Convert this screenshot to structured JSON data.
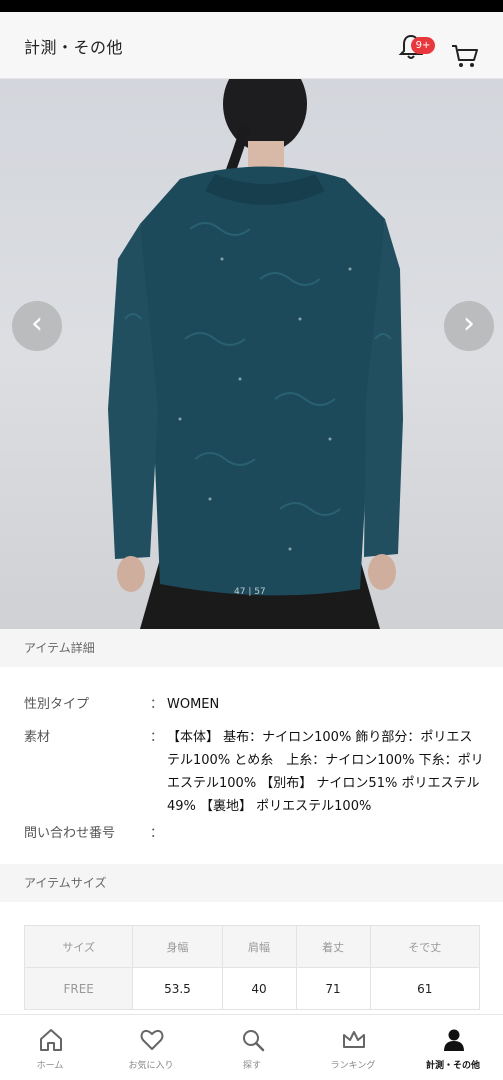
{
  "header": {
    "title": "計測・その他",
    "notification_badge": "9+",
    "bell_icon": "bell-icon",
    "cart_icon": "cart-icon"
  },
  "gallery": {
    "counter": "47 | 57",
    "prev_icon": "chevron-left-icon",
    "next_icon": "chevron-right-icon"
  },
  "item_details": {
    "heading": "アイテム詳細",
    "rows": [
      {
        "label": "性別タイプ",
        "colon": "：",
        "value": "WOMEN"
      },
      {
        "label": "素材",
        "colon": "：",
        "value": "【本体】 基布：ナイロン100% 飾り部分：ポリエステル100% とめ糸　上糸：ナイロン100% 下糸：ポリエステル100% 【別布】 ナイロン51% ポリエステル49% 【裏地】 ポリエステル100%"
      },
      {
        "label": "問い合わせ番号",
        "colon": "：",
        "value": ""
      }
    ]
  },
  "item_size": {
    "heading": "アイテムサイズ",
    "columns": [
      "サイズ",
      "身幅",
      "肩幅",
      "着丈",
      "そで丈"
    ],
    "rows": [
      [
        "FREE",
        "53.5",
        "40",
        "71",
        "61"
      ]
    ]
  },
  "bottom_nav": {
    "items": [
      {
        "label": "ホーム",
        "icon": "home-icon"
      },
      {
        "label": "お気に入り",
        "icon": "heart-icon"
      },
      {
        "label": "探す",
        "icon": "search-icon"
      },
      {
        "label": "ランキング",
        "icon": "crown-icon"
      },
      {
        "label": "計測・その他",
        "icon": "person-icon"
      }
    ],
    "active_index": 4
  },
  "colors": {
    "accent": "#e8383d",
    "garment": "#1d4a5a"
  }
}
